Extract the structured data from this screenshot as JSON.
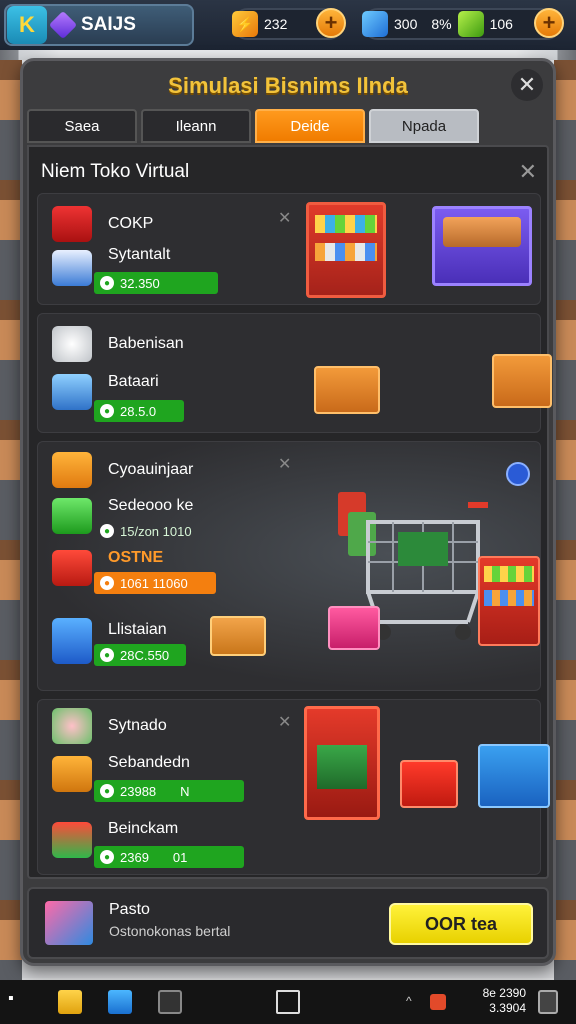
{
  "topbar": {
    "player_name": "SAIJS",
    "logo_letter": "K",
    "coins": "232",
    "gems_blue": "300",
    "gems_pct": "8%",
    "gems_green": "106"
  },
  "dialog": {
    "title": "Simulasi Bisnims Ilnda",
    "tabs": [
      "Saea",
      "Ileann",
      "Deide",
      "Npada"
    ],
    "active_tab": "Deide",
    "panel_title": "Niem Toko Virtual",
    "rows": [
      {
        "label": "COKP",
        "price": ""
      },
      {
        "label": "Sytantalt",
        "price": "32.350"
      },
      {
        "label": "Babenisan",
        "price": ""
      },
      {
        "label": "Bataari",
        "price": "28.5.0"
      },
      {
        "label": "Cyoauinjaar",
        "price": ""
      },
      {
        "label": "Sedeooo ke",
        "price": "15/zon 1010"
      },
      {
        "label": "OSTNE",
        "price": "1061 11060"
      },
      {
        "label": "Llistaian",
        "price": "28C.550"
      },
      {
        "label": "Sytnado",
        "price": ""
      },
      {
        "label": "Sebandedn",
        "price": "23988",
        "extra": "N"
      },
      {
        "label": "Beinckam",
        "price": "2369",
        "extra": "01"
      }
    ],
    "footer": {
      "label": "Pasto",
      "subtitle": "Ostonokonas bertal",
      "button": "OOR tea"
    }
  },
  "taskbar": {
    "time": "8e 2390",
    "date": "3.3904"
  },
  "colors": {
    "accent_orange": "#f07c00",
    "price_green": "#1fa51f",
    "title_gold": "#f2c33b",
    "button_yellow": "#fff23a"
  }
}
